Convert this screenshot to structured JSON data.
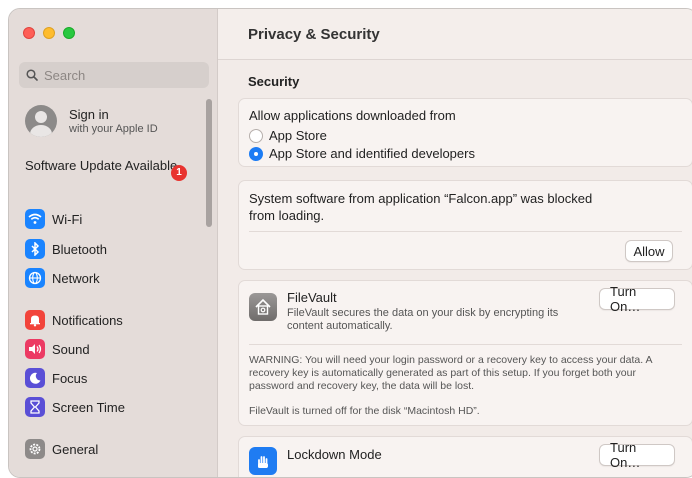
{
  "sidebar": {
    "search_placeholder": "Search",
    "signin": {
      "title": "Sign in",
      "subtitle": "with your Apple ID"
    },
    "update": {
      "label": "Software Update Available",
      "badge": "1"
    },
    "items": [
      {
        "label": "Wi-Fi",
        "icon": "wifi-icon",
        "color": "#1a84ff"
      },
      {
        "label": "Bluetooth",
        "icon": "bluetooth-icon",
        "color": "#1a84ff"
      },
      {
        "label": "Network",
        "icon": "globe-icon",
        "color": "#1a84ff"
      },
      {
        "label": "Notifications",
        "icon": "bell-icon",
        "color": "#f2443b"
      },
      {
        "label": "Sound",
        "icon": "speaker-icon",
        "color": "#ec3a63"
      },
      {
        "label": "Focus",
        "icon": "moon-icon",
        "color": "#5a4fd6"
      },
      {
        "label": "Screen Time",
        "icon": "hourglass-icon",
        "color": "#5a4fd6"
      },
      {
        "label": "General",
        "icon": "gear-icon",
        "color": "#8d8a89"
      }
    ]
  },
  "main": {
    "title": "Privacy & Security",
    "section": "Security",
    "allow_apps": {
      "label": "Allow applications downloaded from",
      "options": [
        "App Store",
        "App Store and identified developers"
      ],
      "selected": 1
    },
    "blocked": {
      "message": "System software from application “Falcon.app” was blocked from loading.",
      "button": "Allow"
    },
    "filevault": {
      "title": "FileVault",
      "description": "FileVault secures the data on your disk by encrypting its content automatically.",
      "button": "Turn On…",
      "warning": "WARNING: You will need your login password or a recovery key to access your data. A recovery key is automatically generated as part of this setup. If you forget both your password and recovery key, the data will be lost.",
      "status": "FileVault is turned off for the disk “Macintosh HD”."
    },
    "lockdown": {
      "title": "Lockdown Mode",
      "button": "Turn On…"
    }
  }
}
